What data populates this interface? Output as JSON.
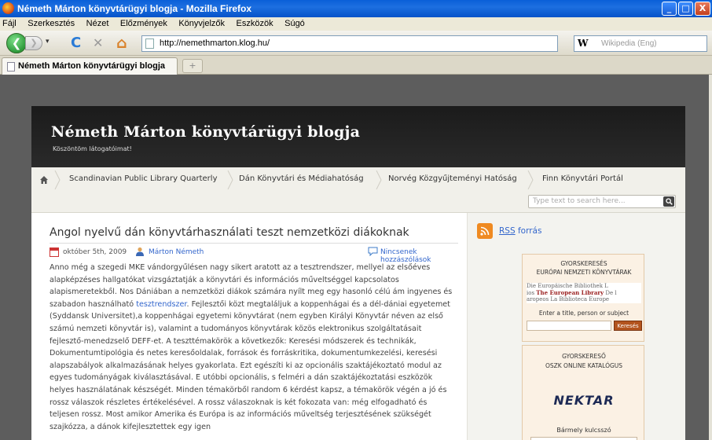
{
  "window": {
    "title": "Németh Márton könyvtárügyi blogja - Mozilla Firefox",
    "controls": {
      "minimize": "_",
      "maximize": "□",
      "close": "X"
    }
  },
  "menu": [
    "Fájl",
    "Szerkesztés",
    "Nézet",
    "Előzmények",
    "Könyvjelzők",
    "Eszközök",
    "Súgó"
  ],
  "toolbar": {
    "back": "❮",
    "forward": "❯",
    "history_dropdown": "▾",
    "reload": "C",
    "stop": "✕",
    "home": "⌂",
    "url": "http://nemethmarton.klog.hu/",
    "bookmark_star": "☆",
    "search_engine": "W",
    "search_placeholder": "Wikipedia (Eng)"
  },
  "tabs": [
    {
      "label": "Németh Márton könyvtárügyi blogja"
    }
  ],
  "new_tab": "+",
  "blog": {
    "title": "Németh Márton könyvtárügyi blogja",
    "subtitle": "Köszöntöm látogatóimat!",
    "nav": [
      "Scandinavian Public Library Quarterly",
      "Dán Könyvtári és Médiahatóság",
      "Norvég Közgyűjteményi Hatóság",
      "Finn Könyvtári Portál"
    ],
    "search_placeholder": "Type text to search here..."
  },
  "post": {
    "title": "Angol nyelvű dán könyvtárhasználati teszt nemzetközi diákoknak",
    "date": "október 5th, 2009",
    "author": "Márton Németh",
    "comments": "Nincsenek hozzászólások",
    "body_before_link": "Anno még a szegedi MKE vándorgyűlésen nagy sikert aratott az a tesztrendszer, mellyel az elsőéves alapképzéses hallgatókat vizsgáztatják a könyvtári és információs műveltséggel kapcsolatos alapismeretekből. Nos Dániában a nemzetközi diákok számára nyílt meg egy hasonló célú ám ingyenes és szabadon használható ",
    "body_link": "tesztrendszer",
    "body_after_link": ". Fejlesztői közt megtaláljuk a koppenhágai és a dél-dániai egyetemet (Syddansk Universitet),a koppenhágai egyetemi könyvtárat (nem egyben Királyi Könyvtár néven az első számú nemzeti könyvtár is), valamint a tudományos könyvtárak közös elektronikus szolgáltatásait fejlesztő-menedzselő DEFF-et.  A teszttémakörök a következők: Keresési módszerek és technikák, Dokumentumtipológia és netes keresőoldalak, források és forráskritika, dokumentumkezelési, keresési alapszabályok alkalmazásának helyes gyakorlata. Ezt egészíti ki az opcionális szaktájékoztató modul az egyes tudományágak kiválasztásával. E utóbbi opcionális, s felméri a dán szaktájékoztatási eszközök helyes használatának készségét. Minden témakörből random 6 kérdést kapsz, a témakörök végén a jó és rossz válaszok részletes értékelésével. A rossz válaszoknak is két fokozata van: még elfogadható és teljesen rossz.  Most amikor Amerika és Európa is az információs műveltség terjesztésének szükségét szajkózza, a dánok kifejlesztettek egy igen"
  },
  "sidebar": {
    "rss_label": "RSS",
    "rss_suffix": " forrás",
    "widget1": {
      "heading_line1": "GYORSKERESÉS",
      "heading_line2": "EURÓPAI NEMZETI KÖNYVTÁRAK",
      "banner_line1": "Die Europäische Bibliothek  L",
      "banner_line2_pre": "ios ",
      "banner_line2_bold": "The European Library",
      "banner_line2_post": " De l",
      "banner_line3": "aropeos  La Biblioteca Europe",
      "help": "Enter a title, person or subject",
      "button": "Keresés"
    },
    "widget2": {
      "heading_line1": "GYORSKERESŐ",
      "heading_line2": "OSZK ONLINE KATALÓGUS",
      "logo": "NEKTAR",
      "keyword_label": "Bármely kulcsszó"
    }
  },
  "colors": {
    "titlebar": "#0a5fd8",
    "header_bg": "#1b1b1b",
    "link": "#3366cc",
    "rss": "#ef8a21",
    "search_button": "#b3541e"
  }
}
